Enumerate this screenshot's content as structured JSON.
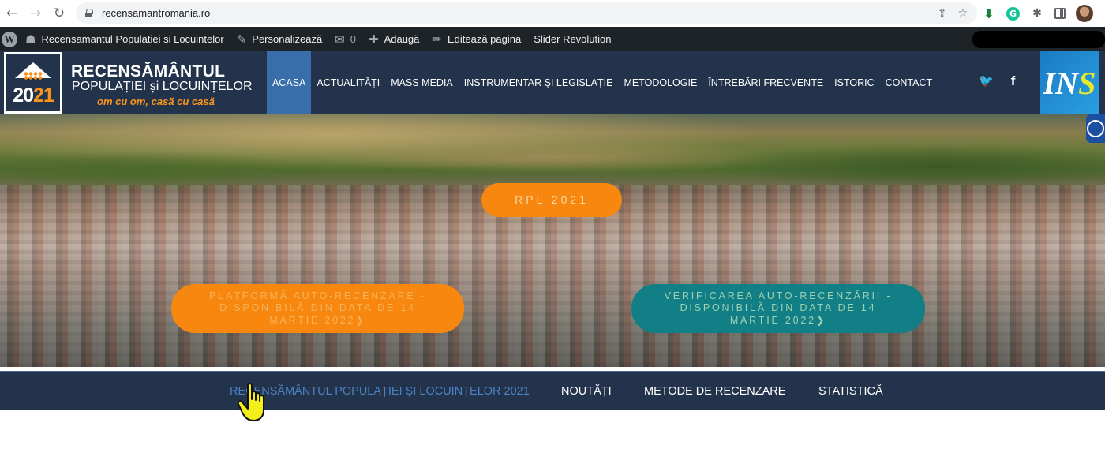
{
  "browser": {
    "url": "recensamantromania.ro",
    "back_icon": "←",
    "forward_icon": "→",
    "reload_icon": "↻",
    "share_icon": "⇪",
    "star_icon": "☆",
    "download_icon": "⬇",
    "grammarly_icon": "G",
    "puzzle_icon": "✱",
    "menu_icon": "⋮"
  },
  "wp_admin": {
    "wp_logo": "W",
    "items": [
      {
        "icon": "☗",
        "label": "Recensamantul Populatiei si Locuintelor"
      },
      {
        "icon": "✎",
        "label": "Personalizează"
      },
      {
        "icon": "✉",
        "label": "0"
      },
      {
        "icon": "✚",
        "label": "Adaugă"
      },
      {
        "icon": "✏",
        "label": "Editează pagina"
      },
      {
        "icon": "",
        "label": "Slider Revolution"
      }
    ]
  },
  "header": {
    "logo": {
      "year_prefix": "20",
      "year_suffix": "21"
    },
    "brand_title": "RECENSĂMÂNTUL",
    "brand_subtitle": "POPULAȚIEI și LOCUINȚELOR",
    "brand_slogan": "om cu om, casă cu casă",
    "nav": [
      {
        "label": "ACASA",
        "active": true
      },
      {
        "label": "ACTUALITĂȚI",
        "active": false
      },
      {
        "label": "MASS MEDIA",
        "active": false
      },
      {
        "label": "INSTRUMENTAR ȘI LEGISLAȚIE",
        "active": false
      },
      {
        "label": "METODOLOGIE",
        "active": false
      },
      {
        "label": "ÎNTREBĂRI FRECVENTE",
        "active": false
      },
      {
        "label": "ISTORIC",
        "active": false
      },
      {
        "label": "CONTACT",
        "active": false
      }
    ],
    "social": {
      "twitter": "🐦",
      "facebook": "f"
    },
    "ins_logo": {
      "main": "IN",
      "accent": "S"
    }
  },
  "hero": {
    "rpl_button": "RPL 2021",
    "platform_button": "PLATFORMĂ AUTO-RECENZARE - DISPONIBILĂ DIN DATA DE 14 MARTIE 2022❯",
    "verify_button": "VERIFICAREA AUTO-RECENZĂRII - DISPONIBILĂ DIN DATA DE 14 MARTIE 2022❯"
  },
  "sub_nav": [
    {
      "label": "RECENSĂMÂNTUL POPULAȚIEI ȘI LOCUINȚELOR 2021",
      "current": true
    },
    {
      "label": "NOUTĂȚI",
      "current": false
    },
    {
      "label": "METODE DE RECENZARE",
      "current": false
    },
    {
      "label": "STATISTICĂ",
      "current": false
    }
  ],
  "colors": {
    "header_bg": "#23334c",
    "active_nav": "#3a6eaa",
    "orange": "#f7870f",
    "teal": "#127f86",
    "wp_bar": "#1d2327"
  }
}
